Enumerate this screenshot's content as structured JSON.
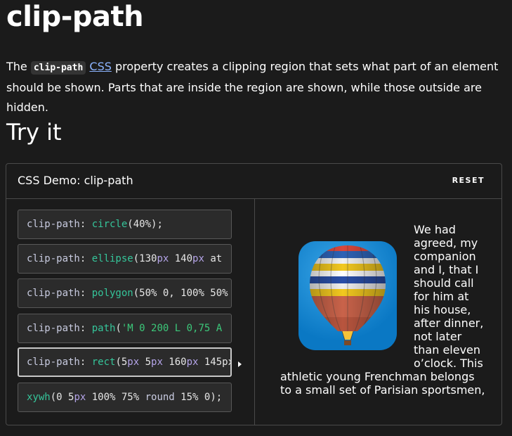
{
  "page": {
    "title": "clip-path",
    "intro_before": "The ",
    "intro_code": "clip-path",
    "intro_link": "CSS",
    "intro_after": " property creates a clipping region that sets what part of an element should be shown. Parts that are inside the region are shown, while those outside are hidden.",
    "section_title": "Try it"
  },
  "demo": {
    "title": "CSS Demo: clip-path",
    "reset_label": "RESET",
    "examples": [
      [
        {
          "t": "prop",
          "v": "clip-path"
        },
        {
          "t": "punc",
          "v": ": "
        },
        {
          "t": "fn",
          "v": "circle"
        },
        {
          "t": "punc",
          "v": "(40%);"
        }
      ],
      [
        {
          "t": "prop",
          "v": "clip-path"
        },
        {
          "t": "punc",
          "v": ": "
        },
        {
          "t": "fn",
          "v": "ellipse"
        },
        {
          "t": "punc",
          "v": "(130"
        },
        {
          "t": "unit",
          "v": "px"
        },
        {
          "t": "num",
          "v": " 140"
        },
        {
          "t": "unit",
          "v": "px"
        },
        {
          "t": "punc",
          "v": " at"
        }
      ],
      [
        {
          "t": "prop",
          "v": "clip-path"
        },
        {
          "t": "punc",
          "v": ": "
        },
        {
          "t": "fn",
          "v": "polygon"
        },
        {
          "t": "punc",
          "v": "(50% 0, 100% 50%"
        }
      ],
      [
        {
          "t": "prop",
          "v": "clip-path"
        },
        {
          "t": "punc",
          "v": ": "
        },
        {
          "t": "fn",
          "v": "path"
        },
        {
          "t": "punc",
          "v": "("
        },
        {
          "t": "str",
          "v": "'M 0 200 L 0,75 A"
        }
      ],
      [
        {
          "t": "prop",
          "v": "clip-path"
        },
        {
          "t": "punc",
          "v": ": "
        },
        {
          "t": "fn",
          "v": "rect"
        },
        {
          "t": "punc",
          "v": "(5"
        },
        {
          "t": "unit",
          "v": "px"
        },
        {
          "t": "num",
          "v": " 5"
        },
        {
          "t": "unit",
          "v": "px"
        },
        {
          "t": "num",
          "v": " 160"
        },
        {
          "t": "unit",
          "v": "px"
        },
        {
          "t": "num",
          "v": " 145px"
        }
      ],
      [
        {
          "t": "fn",
          "v": "xywh"
        },
        {
          "t": "punc",
          "v": "(0 5"
        },
        {
          "t": "unit",
          "v": "px"
        },
        {
          "t": "num",
          "v": " 100% 75% "
        },
        {
          "t": "prop",
          "v": "round"
        },
        {
          "t": "num",
          "v": " 15% 0);"
        }
      ]
    ],
    "selected_index": 4,
    "sample_text": "We had agreed, my companion and I, that I should call for him at his house, after dinner, not later than eleven o’clock. This athletic young Frenchman belongs to a small set of Parisian sportsmen,"
  },
  "colors": {
    "background": "#1b1b1b",
    "panel_border": "#4a4a4a",
    "link": "#8cb4ff",
    "function_green": "#35c59a",
    "string_green": "#3cc87a",
    "unit_purple": "#b4a4e8"
  },
  "icons": [
    "hot-air-balloon-image",
    "caret-right-icon"
  ]
}
